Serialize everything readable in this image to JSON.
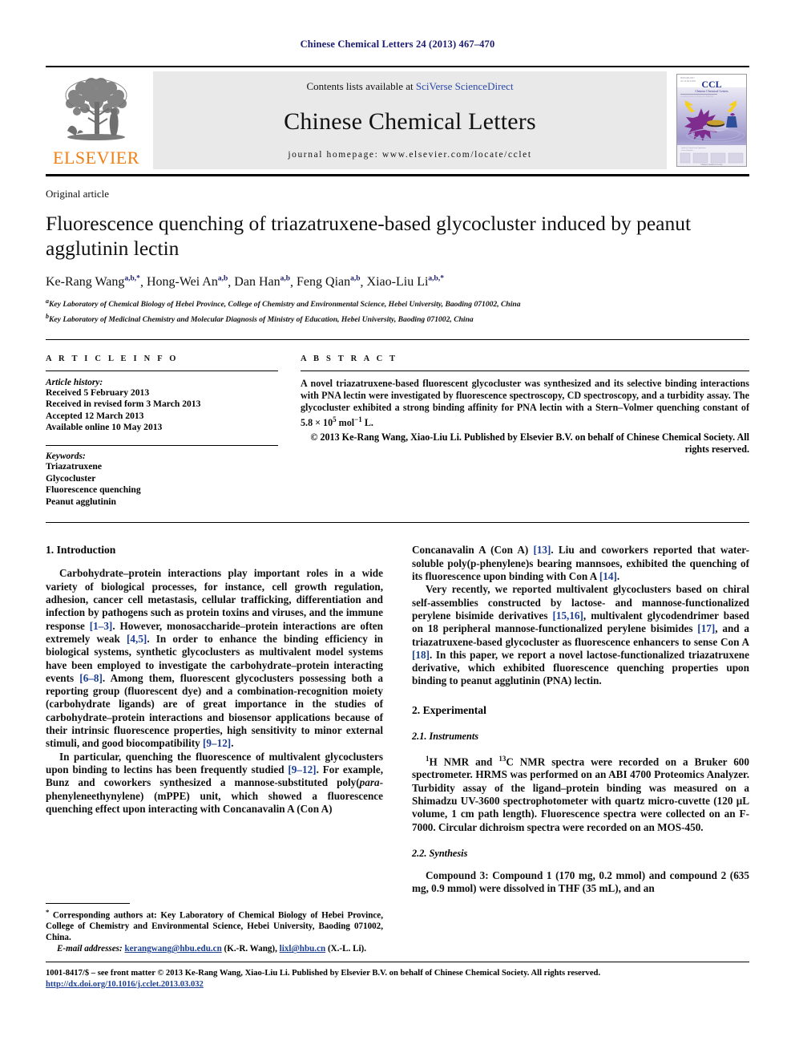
{
  "running_head": "Chinese Chemical Letters 24 (2013) 467–470",
  "masthead": {
    "contents_prefix": "Contents lists available at ",
    "sciencedirect": "SciVerse ScienceDirect",
    "journal_name": "Chinese Chemical Letters",
    "homepage": "journal homepage: www.elsevier.com/locate/cclet",
    "publisher_logo_text": "ELSEVIER",
    "cover_title": "CCL",
    "cover_subtitle": "Chinese Chemical Letters"
  },
  "article": {
    "type": "Original article",
    "title": "Fluorescence quenching of triazatruxene-based glycocluster induced by peanut agglutinin lectin",
    "authors": [
      {
        "name": "Ke-Rang Wang",
        "sup": "a,b,*"
      },
      {
        "name": "Hong-Wei An",
        "sup": "a,b"
      },
      {
        "name": "Dan Han",
        "sup": "a,b"
      },
      {
        "name": "Feng Qian",
        "sup": "a,b"
      },
      {
        "name": "Xiao-Liu Li",
        "sup": "a,b,*"
      }
    ],
    "affiliations": [
      {
        "sup": "a",
        "text": "Key Laboratory of Chemical Biology of Hebei Province, College of Chemistry and Environmental Science, Hebei University, Baoding 071002, China"
      },
      {
        "sup": "b",
        "text": "Key Laboratory of Medicinal Chemistry and Molecular Diagnosis of Ministry of Education, Hebei University, Baoding 071002, China"
      }
    ]
  },
  "info": {
    "heading": "A R T I C L E   I N F O",
    "history_label": "Article history:",
    "history": [
      "Received 5 February 2013",
      "Received in revised form 3 March 2013",
      "Accepted 12 March 2013",
      "Available online 10 May 2013"
    ],
    "keywords_label": "Keywords:",
    "keywords": [
      "Triazatruxene",
      "Glycocluster",
      "Fluorescence quenching",
      "Peanut agglutinin"
    ]
  },
  "abstract": {
    "heading": "A B S T R A C T",
    "body_part1": "A novel triazatruxene-based fluorescent glycocluster was synthesized and its selective binding interactions with PNA lectin were investigated by fluorescence spectroscopy, CD spectroscopy, and a turbidity assay. The glycocluster exhibited a strong binding affinity for PNA lectin with a Stern–Volmer quenching constant of 5.8 × 10",
    "exponent": "5",
    "body_part2": " mol",
    "exponent2": "−1",
    "body_part3": " L.",
    "copyright_line1": "© 2013 Ke-Rang Wang, Xiao-Liu Li. Published by Elsevier B.V. on behalf of Chinese Chemical Society. All",
    "copyright_line2": "rights reserved."
  },
  "sections": {
    "introduction_heading": "1. Introduction",
    "experimental_heading": "2. Experimental",
    "instruments_heading": "2.1. Instruments",
    "synthesis_heading": "2.2. Synthesis"
  },
  "body": {
    "intro_p1_a": "Carbohydrate–protein interactions play important roles in a wide variety of biological processes, for instance, cell growth regulation, adhesion, cancer cell metastasis, cellular trafficking, differentiation and infection by pathogens such as protein toxins and viruses, and the immune response ",
    "ref1": "[1–3]",
    "intro_p1_b": ". However, monosaccharide–protein interactions are often extremely weak ",
    "ref2": "[4,5]",
    "intro_p1_c": ". In order to enhance the binding efficiency in biological systems, synthetic glycoclusters as multivalent model systems have been employed to investigate the carbohydrate–protein interacting events ",
    "ref3": "[6–8]",
    "intro_p1_d": ". Among them, fluorescent glycoclusters possessing both a reporting group (fluorescent dye) and a combination-recognition moiety (carbohydrate ligands) are of great importance in the studies of carbohydrate–protein interactions and biosensor applications because of their intrinsic fluorescence properties, high sensitivity to minor external stimuli, and good biocompatibility ",
    "ref4": "[9–12]",
    "intro_p1_e": ".",
    "intro_p2_a": "In particular, quenching the fluorescence of multivalent glycoclusters upon binding to lectins has been frequently studied ",
    "ref5": "[9–12]",
    "intro_p2_b": ". For example, Bunz and coworkers synthesized a mannose-substituted poly(",
    "intro_p2_italic": "para",
    "intro_p2_c": "-phenyleneethynylene) (mPPE) unit, which showed a fluorescence quenching effect upon interacting with Concanavalin A (Con A) ",
    "ref6": "[13]",
    "intro_p2_d": ". Liu and coworkers reported that water-soluble poly(p-phenylene)s bearing mannsoes, exhibited the quenching of its fluorescence upon binding with Con A ",
    "ref7": "[14]",
    "intro_p2_e": ".",
    "intro_p3_a": "Very recently, we reported multivalent glycoclusters based on chiral self-assemblies constructed by lactose- and mannose-functionalized perylene bisimide derivatives ",
    "ref8": "[15,16]",
    "intro_p3_b": ", multivalent glycodendrimer based on 18 peripheral mannose-functionalized perylene bisimides ",
    "ref9": "[17]",
    "intro_p3_c": ", and a triazatruxene-based glycocluster as fluorescence enhancers to sense Con A ",
    "ref10": "[18]",
    "intro_p3_d": ". In this paper, we report a novel lactose-functionalized triazatruxene derivative, which exhibited fluorescence quenching properties upon binding to peanut agglutinin (PNA) lectin.",
    "instruments_p_a": "H NMR and ",
    "instruments_sup1": "1",
    "instruments_sup2": "13",
    "instruments_p_b": "C NMR spectra were recorded on a Bruker 600 spectrometer. HRMS was performed on an ABI 4700 Proteomics Analyzer. Turbidity assay of the ligand–protein binding was measured on a Shimadzu UV-3600 spectrophotometer with quartz micro-cuvette (120 μL volume, 1 cm path length). Fluorescence spectra were collected on an F-7000. Circular dichroism spectra were recorded on an MOS-450.",
    "synthesis_p_a": "Compound ",
    "synthesis_b1": "3",
    "synthesis_p_b": ": Compound ",
    "synthesis_b2": "1",
    "synthesis_p_c": " (170 mg, 0.2 mmol) and compound ",
    "synthesis_b3": "2",
    "synthesis_p_d": " (635 mg, 0.9 mmol) were dissolved in THF (35 mL), and an"
  },
  "footnote": {
    "star": "*",
    "corresponding": " Corresponding authors at: Key Laboratory of Chemical Biology of Hebei Province, College of Chemistry and Environmental Science, Hebei University, Baoding 071002, China.",
    "email_label": "E-mail addresses:",
    "email1": "kerangwang@hbu.edu.cn",
    "email1_owner": " (K.-R. Wang), ",
    "email2": "lixl@hbu.cn",
    "email2_owner": " (X.-L. Li)."
  },
  "issn": {
    "line1": "1001-8417/$ – see front matter © 2013 Ke-Rang Wang, Xiao-Liu Li. Published by Elsevier B.V. on behalf of Chinese Chemical Society. All rights reserved.",
    "doi": "http://dx.doi.org/10.1016/j.cclet.2013.03.032"
  },
  "colors": {
    "link_blue": "#2b48a8",
    "ref_blue": "#1c3f94",
    "elsevier_orange": "#F07F13",
    "masthead_gray": "#e9e9e9"
  }
}
